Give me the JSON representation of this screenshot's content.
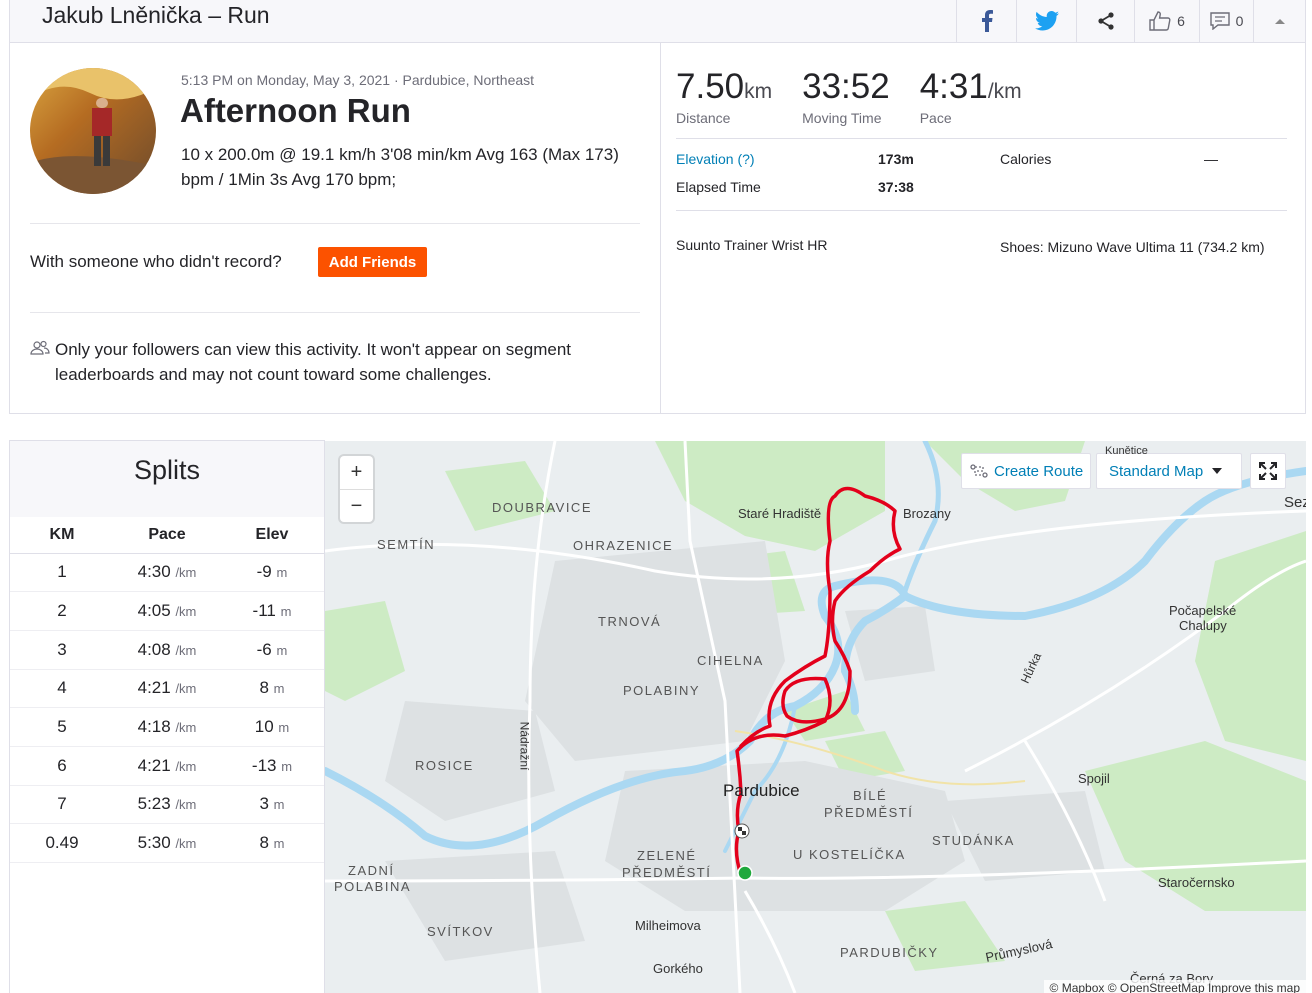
{
  "header": {
    "title": "Jakub Lněnička – Run",
    "kudos_count": "6",
    "comment_count": "0"
  },
  "activity": {
    "meta": "5:13 PM on Monday, May 3, 2021 · Pardubice, Northeast",
    "name": "Afternoon Run",
    "description": "10 x 200.0m @ 19.1 km/h 3'08 min/km Avg 163 (Max 173) bpm / 1Min 3s Avg 170 bpm;",
    "with_someone": "With someone who didn't record?",
    "add_friends": "Add Friends",
    "privacy": "Only your followers can view this activity. It won't appear on segment leaderboards and may not count toward some challenges."
  },
  "stats": {
    "distance": {
      "value": "7.50",
      "unit": "km",
      "label": "Distance"
    },
    "moving_time": {
      "value": "33:52",
      "label": "Moving Time"
    },
    "pace": {
      "value": "4:31",
      "unit": "/km",
      "label": "Pace"
    },
    "elevation_label": "Elevation (?)",
    "elevation_value": "173m",
    "calories_label": "Calories",
    "calories_value": "—",
    "elapsed_label": "Elapsed Time",
    "elapsed_value": "37:38",
    "device": "Suunto Trainer Wrist HR",
    "shoes": "Shoes: Mizuno Wave Ultima 11 (734.2 km)"
  },
  "splits": {
    "title": "Splits",
    "headers": [
      "KM",
      "Pace",
      "Elev"
    ],
    "pace_unit": "/km",
    "elev_unit": "m",
    "rows": [
      {
        "km": "1",
        "pace": "4:30",
        "elev": "-9"
      },
      {
        "km": "2",
        "pace": "4:05",
        "elev": "-11"
      },
      {
        "km": "3",
        "pace": "4:08",
        "elev": "-6"
      },
      {
        "km": "4",
        "pace": "4:21",
        "elev": "8"
      },
      {
        "km": "5",
        "pace": "4:18",
        "elev": "10"
      },
      {
        "km": "6",
        "pace": "4:21",
        "elev": "-13"
      },
      {
        "km": "7",
        "pace": "5:23",
        "elev": "3"
      },
      {
        "km": "0.49",
        "pace": "5:30",
        "elev": "8"
      }
    ]
  },
  "map": {
    "zoom_in": "+",
    "zoom_out": "−",
    "create_route": "Create Route",
    "standard_map": "Standard Map",
    "labels": {
      "kunetice": "Kunětice",
      "doubravice": "DOUBRAVICE",
      "stare_hradiste": "Staré Hradiště",
      "brozany": "Brozany",
      "sez": "Sez",
      "semtin": "SEMTÍN",
      "ohrazenice": "OHRAZENICE",
      "trnova": "TRNOVÁ",
      "pocapelske": "Počapelské",
      "chalupy": "Chalupy",
      "cihelna": "CIHELNA",
      "polabiny": "POLABINY",
      "hurka": "Hůrka",
      "nadrazni": "Nádražní",
      "rosice": "ROSICE",
      "spojil": "Spojil",
      "pardubice": "Pardubice",
      "bile": "BÍLÉ",
      "predmesti": "PŘEDMĚSTÍ",
      "studanka": "STUDÁNKA",
      "zelene": "ZELENÉ",
      "zelene2": "PŘEDMĚSTÍ",
      "u_kostelicka": "U KOSTELÍČKA",
      "zadni": "ZADNÍ",
      "polabina": "POLABINA",
      "starocernsko": "Staročernsko",
      "svitkov": "SVÍTKOV",
      "milheimova": "Milheimova",
      "pardubicky": "PARDUBIČKY",
      "prumyslova": "Průmyslová",
      "gorkeho": "Gorkého",
      "cerna": "Černá za Bory"
    },
    "attribution": "© Mapbox © OpenStreetMap Improve this map",
    "route_color": "#e3001b",
    "river_color": "#aad8f2"
  },
  "colors": {
    "accent": "#fc5200",
    "link": "#007fb6"
  }
}
